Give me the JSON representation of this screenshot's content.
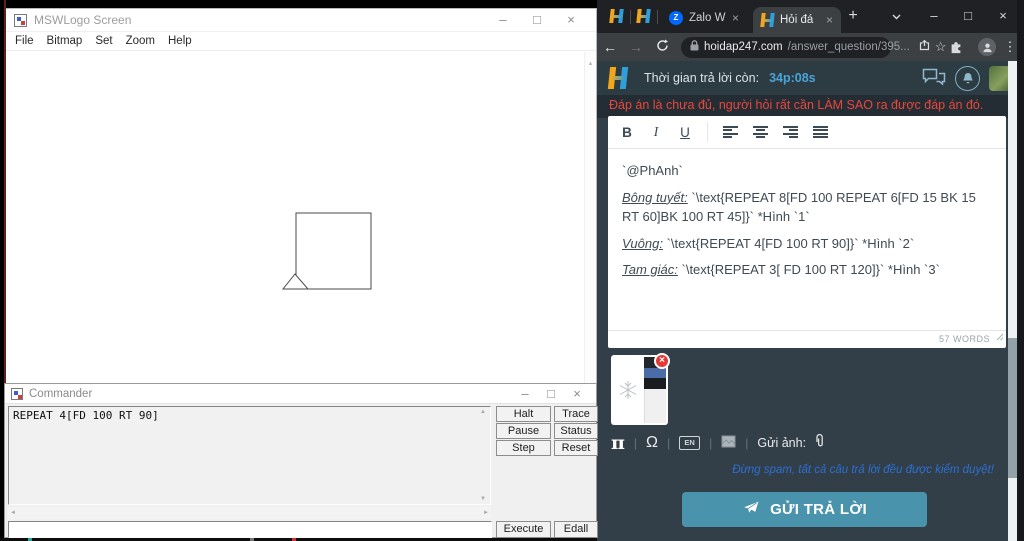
{
  "colors": {
    "accent_blue": "#4aa3d9",
    "warning_red": "#e8473f",
    "submit_teal": "#4a93ad",
    "note_blue": "#2b6fd4",
    "logo_yellow": "#f2a71b",
    "logo_blue": "#2e9fd8"
  },
  "icons": {
    "back": "←",
    "forward": "→",
    "star": "☆",
    "menu_dots": "⋮",
    "new_tab": "+",
    "tab_close": "×",
    "win_min": "–",
    "win_max": "□",
    "win_close": "×",
    "scroll_up": "▲",
    "scroll_down": "▼",
    "scroll_left": "◄",
    "scroll_right": "►",
    "thumb_close": "×",
    "zalo_letter": "Z"
  },
  "mswlogo": {
    "title": "MSWLogo Screen",
    "menus": [
      "File",
      "Bitmap",
      "Set",
      "Zoom",
      "Help"
    ]
  },
  "commander": {
    "title": "Commander",
    "history_text": "REPEAT 4[FD 100 RT 90]",
    "input_value": "",
    "buttons": {
      "halt": "Halt",
      "trace": "Trace",
      "pause": "Pause",
      "status": "Status",
      "step": "Step",
      "reset": "Reset",
      "execute": "Execute",
      "edall": "Edall"
    }
  },
  "browser": {
    "tab_zalo": "Zalo W",
    "tab_active": "Hỏi đá",
    "url_host": "hoidap247.com",
    "url_path": "/answer_question/395..."
  },
  "page": {
    "timer_label": "Thời gian trả lời còn:",
    "timer_value": "34p:08s",
    "warning": "Đáp án là chưa đủ, người hỏi rất cần LÀM SAO ra được đáp án đó.",
    "editor": {
      "bold": "B",
      "italic": "I",
      "underline": "U",
      "lines": [
        {
          "label": "",
          "text": "`@PhAnh`"
        },
        {
          "label": "Bông tuyết:",
          "text": " `\\text{REPEAT 8[FD 100 REPEAT 6[FD 15 BK 15 RT 60]BK 100 RT 45]}` *Hình `1`"
        },
        {
          "label": "Vuông:",
          "text": " `\\text{REPEAT 4[FD 100 RT 90]}` *Hình `2`"
        },
        {
          "label": "Tam giác:",
          "text": " `\\text{REPEAT 3[ FD 100 RT 120]}` *Hình `3`"
        }
      ],
      "word_count": "57 WORDS"
    },
    "tools": {
      "pi": "π",
      "omega": "Ω",
      "badge": "EN",
      "send_image_label": "Gửi ảnh:"
    },
    "moderation_note": "Đừng spam, tất cả câu trả lời đều được kiểm duyệt!",
    "submit_label": "GỬI TRẢ LỜI"
  }
}
